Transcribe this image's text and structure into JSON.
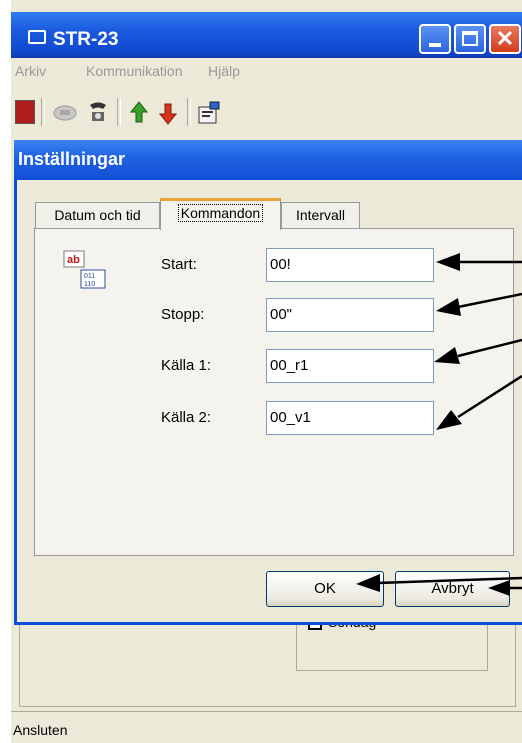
{
  "main_window": {
    "title": "STR-23",
    "menu": [
      "Arkiv",
      "Kommunikation",
      "Hjälp"
    ],
    "status_text": "Ansluten",
    "background_checkbox_label": "Sondag"
  },
  "dialog": {
    "title": "Inställningar",
    "tabs": [
      {
        "label": "Datum och tid"
      },
      {
        "label": "Kommandon"
      },
      {
        "label": "Intervall"
      }
    ],
    "active_tab": "Kommandon",
    "fields": [
      {
        "label": "Start:",
        "value": "00!"
      },
      {
        "label": "Stopp:",
        "value": "00\""
      },
      {
        "label": "Källa 1:",
        "value": "00_r1"
      },
      {
        "label": "Källa 2:",
        "value": "00_v1"
      }
    ],
    "ok_label": "OK",
    "cancel_label": "Avbryt"
  },
  "icons": [
    "app-icon",
    "minimize-icon",
    "maximize-icon",
    "close-icon",
    "exit-icon",
    "phone-icon",
    "dial-icon",
    "upload-icon",
    "download-icon",
    "settings-icon",
    "text-field-icon"
  ],
  "colors": {
    "titlebar": "#1a5ae0",
    "dialog_frame": "#0b4fd8",
    "face": "#ece9d8",
    "close": "#e04a2c"
  }
}
